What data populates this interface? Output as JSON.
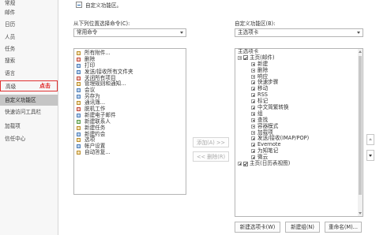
{
  "sidebar": {
    "items": [
      "常规",
      "邮件",
      "日历",
      "人员",
      "任务",
      "搜索",
      "语言",
      "高级",
      "自定义功能区",
      "快速访问工具栏",
      "加载项",
      "信任中心"
    ],
    "annotation": "点击"
  },
  "header": {
    "title": "自定义功能区。"
  },
  "left_panel": {
    "label": "从下列位置选择命令(C):",
    "dropdown_value": "常用命令",
    "commands": [
      {
        "label": "所有附件...",
        "icon": "attachment-icon"
      },
      {
        "label": "删除",
        "icon": "delete-icon"
      },
      {
        "label": "打印",
        "icon": "print-icon"
      },
      {
        "label": "发送/接收所有文件夹",
        "icon": "send-receive-icon"
      },
      {
        "label": "关闭所有项目",
        "icon": "close-items-icon"
      },
      {
        "label": "管理规则和通知...",
        "icon": "rules-icon"
      },
      {
        "label": "会议",
        "icon": "meeting-icon"
      },
      {
        "label": "另存为",
        "icon": "save-as-icon"
      },
      {
        "label": "通讯簿...",
        "icon": "address-book-icon"
      },
      {
        "label": "脱机工作",
        "icon": "offline-icon"
      },
      {
        "label": "新建电子邮件",
        "icon": "new-email-icon"
      },
      {
        "label": "新建联系人",
        "icon": "new-contact-icon"
      },
      {
        "label": "新建任务",
        "icon": "new-task-icon"
      },
      {
        "label": "新建约会",
        "icon": "new-appointment-icon"
      },
      {
        "label": "选项",
        "icon": "options-icon"
      },
      {
        "label": "帐户设置",
        "icon": "account-settings-icon"
      },
      {
        "label": "自动答复...",
        "icon": "auto-reply-icon"
      }
    ]
  },
  "middle": {
    "add_label": "添加(A) >>",
    "remove_label": "<< 删除(R)"
  },
  "right_panel": {
    "label": "自定义功能区(B):",
    "dropdown_value": "主选项卡",
    "tree_header": "主选项卡",
    "top_tab": "主页(邮件)",
    "groups": [
      "新建",
      "删除",
      "响应",
      "快速步骤",
      "移动",
      "RSS",
      "标记",
      "中文简繁转换",
      "组",
      "查找",
      "容器模式",
      "加载项",
      "发送/接收(IMAP/POP)",
      "Evernote",
      "为知笔记",
      "微云"
    ],
    "bottom_tab": "主页(日历表视图)",
    "buttons": {
      "new_tab": "新建选项卡(W)",
      "new_group": "新建组(N)",
      "rename": "重命名(M)..."
    }
  },
  "colors": {
    "accent_red": "#e02020",
    "selected_bg": "#c5c5c5"
  }
}
